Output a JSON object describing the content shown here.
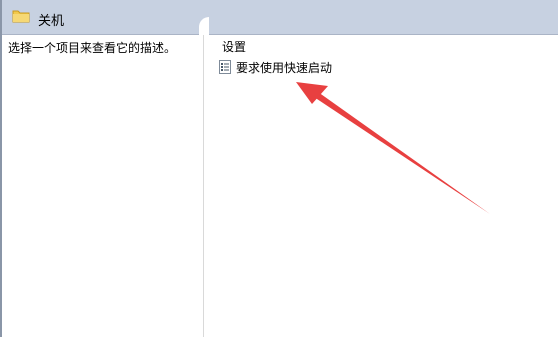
{
  "header": {
    "title": "关机",
    "icon": "folder-icon"
  },
  "left_pane": {
    "description_prompt": "选择一个项目来查看它的描述。"
  },
  "right_pane": {
    "column_header": "设置",
    "items": [
      {
        "label": "要求使用快速启动",
        "icon": "policy-setting-icon"
      }
    ]
  },
  "annotation": {
    "type": "arrow",
    "color": "#e84040"
  }
}
